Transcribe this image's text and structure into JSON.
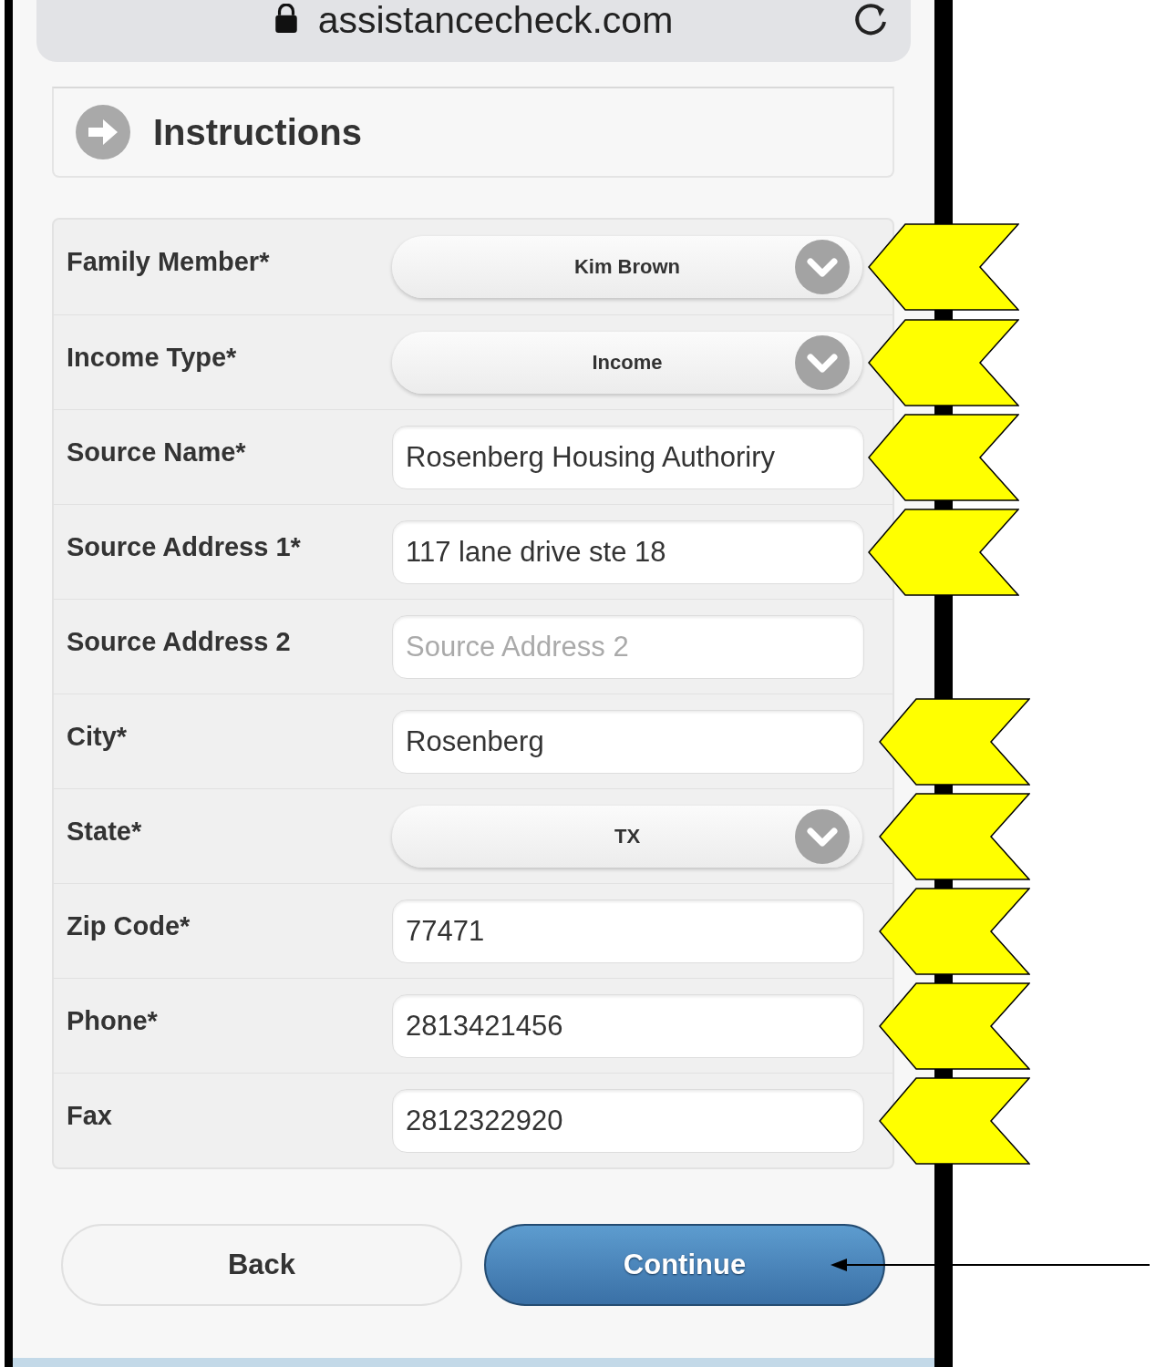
{
  "address_bar": {
    "url": "assistancecheck.com"
  },
  "section": {
    "title": "Instructions"
  },
  "fields": [
    {
      "label": "Family Member*",
      "kind": "select",
      "value": "Kim Brown",
      "marked": true
    },
    {
      "label": "Income Type*",
      "kind": "select",
      "value": "Income",
      "marked": true
    },
    {
      "label": "Source Name*",
      "kind": "input",
      "value": "Rosenberg Housing Authoriry",
      "marked": true
    },
    {
      "label": "Source Address 1*",
      "kind": "input",
      "value": "117 lane drive ste 18",
      "marked": true
    },
    {
      "label": "Source Address 2",
      "kind": "input",
      "placeholder": "Source Address 2",
      "marked": false
    },
    {
      "label": "City*",
      "kind": "input",
      "value": "Rosenberg",
      "marked": true
    },
    {
      "label": "State*",
      "kind": "select",
      "value": "TX",
      "marked": true
    },
    {
      "label": "Zip Code*",
      "kind": "input",
      "value": "77471",
      "marked": true
    },
    {
      "label": "Phone*",
      "kind": "input",
      "value": "2813421456",
      "marked": true
    },
    {
      "label": "Fax",
      "kind": "input",
      "value": "2812322920",
      "marked": true
    }
  ],
  "buttons": [
    {
      "label": "Back",
      "kind": "secondary",
      "marked": false
    },
    {
      "label": "Continue",
      "kind": "primary",
      "marked": true
    }
  ]
}
